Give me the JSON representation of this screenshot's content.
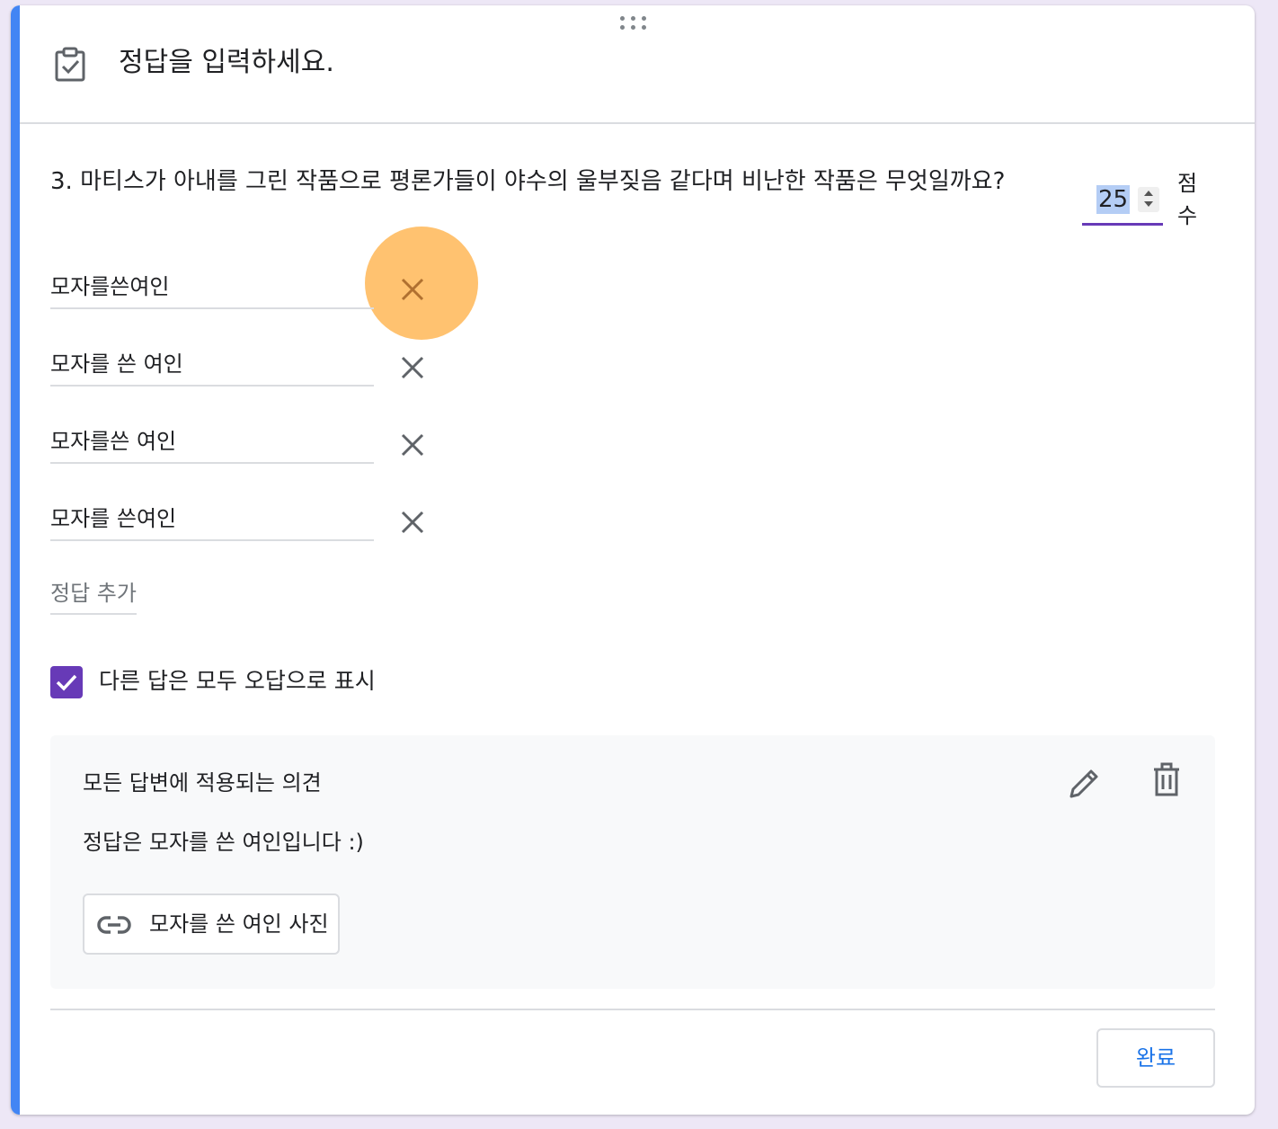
{
  "header": {
    "title": "정답을 입력하세요.",
    "icon": "clipboard-check-icon"
  },
  "question": {
    "text": "3. 마티스가 아내를 그린 작품으로 평론가들이 야수의 울부짖음 같다며 비난한 작품은 무엇일까요?",
    "points_value": "25",
    "points_label": "점수"
  },
  "answers": [
    {
      "text": "모자를쓴여인"
    },
    {
      "text": "모자를 쓴 여인"
    },
    {
      "text": "모자를쓴 여인"
    },
    {
      "text": "모자를 쓴여인"
    }
  ],
  "add_answer_label": "정답 추가",
  "mark_others_incorrect": {
    "label": "다른 답은 모두 오답으로 표시",
    "checked": true
  },
  "feedback": {
    "title": "모든 답변에 적용되는 의견",
    "text": "정답은 모자를 쓴 여인입니다 :)",
    "link_label": "모자를 쓴 여인 사진"
  },
  "done_label": "완료",
  "colors": {
    "accent_bar": "#4285f4",
    "checkbox": "#673ab7",
    "highlight": "#ffad40",
    "done_text": "#1a73e8"
  }
}
